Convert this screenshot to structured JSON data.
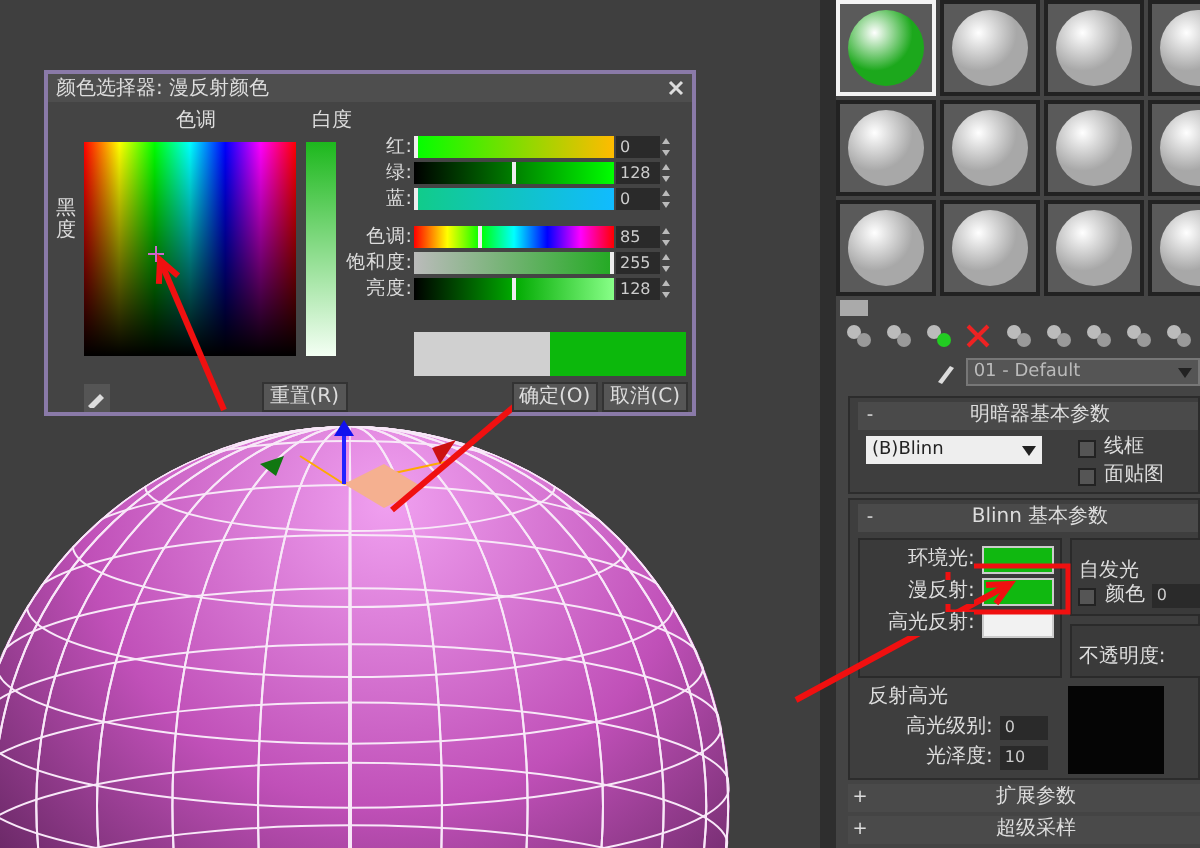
{
  "color_dialog": {
    "title": "颜色选择器: 漫反射颜色",
    "hue_label": "色调",
    "whiteness_label": "白度",
    "blackness_label": "黑度",
    "channels": [
      {
        "label": "红:",
        "value": "0",
        "level": 0
      },
      {
        "label": "绿:",
        "value": "128",
        "level": 0.5
      },
      {
        "label": "蓝:",
        "value": "0",
        "level": 0
      },
      {
        "label": "色调:",
        "value": "85",
        "level": 0.33
      },
      {
        "label": "饱和度:",
        "value": "255",
        "level": 1
      },
      {
        "label": "亮度:",
        "value": "128",
        "level": 0.5
      }
    ],
    "buttons": [
      {
        "kind": "reset",
        "label": "重置(R)"
      },
      {
        "kind": "ok",
        "label": "确定(O)"
      },
      {
        "kind": "cancel",
        "label": "取消(C)"
      }
    ]
  },
  "material_slots": [
    {
      "selected": true,
      "color": "#1ca81c"
    },
    {
      "selected": false,
      "color": "#a8a8a8"
    },
    {
      "selected": false,
      "color": "#a8a8a8"
    },
    {
      "selected": false,
      "color": "#a8a8a8"
    },
    {
      "selected": false,
      "color": "#a8a8a8"
    },
    {
      "selected": false,
      "color": "#a8a8a8"
    },
    {
      "selected": false,
      "color": "#a8a8a8"
    },
    {
      "selected": false,
      "color": "#a8a8a8"
    },
    {
      "selected": false,
      "color": "#a8a8a8"
    },
    {
      "selected": false,
      "color": "#a8a8a8"
    },
    {
      "selected": false,
      "color": "#a8a8a8"
    },
    {
      "selected": false,
      "color": "#a8a8a8"
    }
  ],
  "material_name": "01 - Default",
  "shader_rollout": {
    "toggle": "-",
    "title": "明暗器基本参数",
    "shader": "(B)Blinn",
    "options": [
      {
        "label": "线框",
        "checked": false
      },
      {
        "label": "面贴图",
        "checked": false
      }
    ]
  },
  "blinn_rollout": {
    "toggle": "-",
    "title": "Blinn 基本参数",
    "colors": [
      {
        "label": "环境光:",
        "color": "#10b810"
      },
      {
        "label": "漫反射:",
        "color": "#10b810"
      },
      {
        "label": "高光反射:",
        "color": "#f2f2f2"
      }
    ],
    "self_illum": {
      "title": "自发光",
      "option": {
        "label": "颜色",
        "checked": false
      },
      "value": "0"
    },
    "opacity_label": "不透明度:",
    "specular": {
      "title": "反射高光",
      "fields": [
        {
          "label": "高光级别:",
          "value": "0"
        },
        {
          "label": "光泽度:",
          "value": "10"
        }
      ]
    }
  },
  "collapsed_rollouts": [
    {
      "toggle": "+",
      "title": "扩展参数"
    },
    {
      "toggle": "+",
      "title": "超级采样"
    }
  ]
}
